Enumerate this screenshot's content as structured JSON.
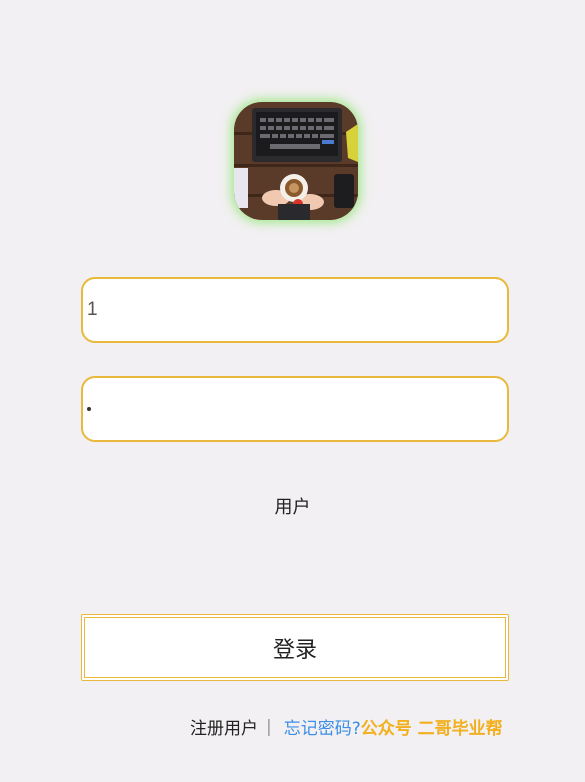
{
  "login_form": {
    "username_value": "1",
    "password_masked": "•",
    "role_label": "用户",
    "login_button_label": "登录"
  },
  "footer": {
    "register_link": "注册用户",
    "separator": "|",
    "forgot_link": "忘记密码?",
    "watermark": "公众号 二哥毕业帮"
  },
  "colors": {
    "background": "#f2f0f2",
    "input_border": "#e8b93a",
    "link_blue": "#3a8ee6",
    "watermark": "#f2b01e",
    "logo_glow": "#8ce66e"
  },
  "icons": {
    "logo": "laptop-coffee-logo-icon"
  }
}
